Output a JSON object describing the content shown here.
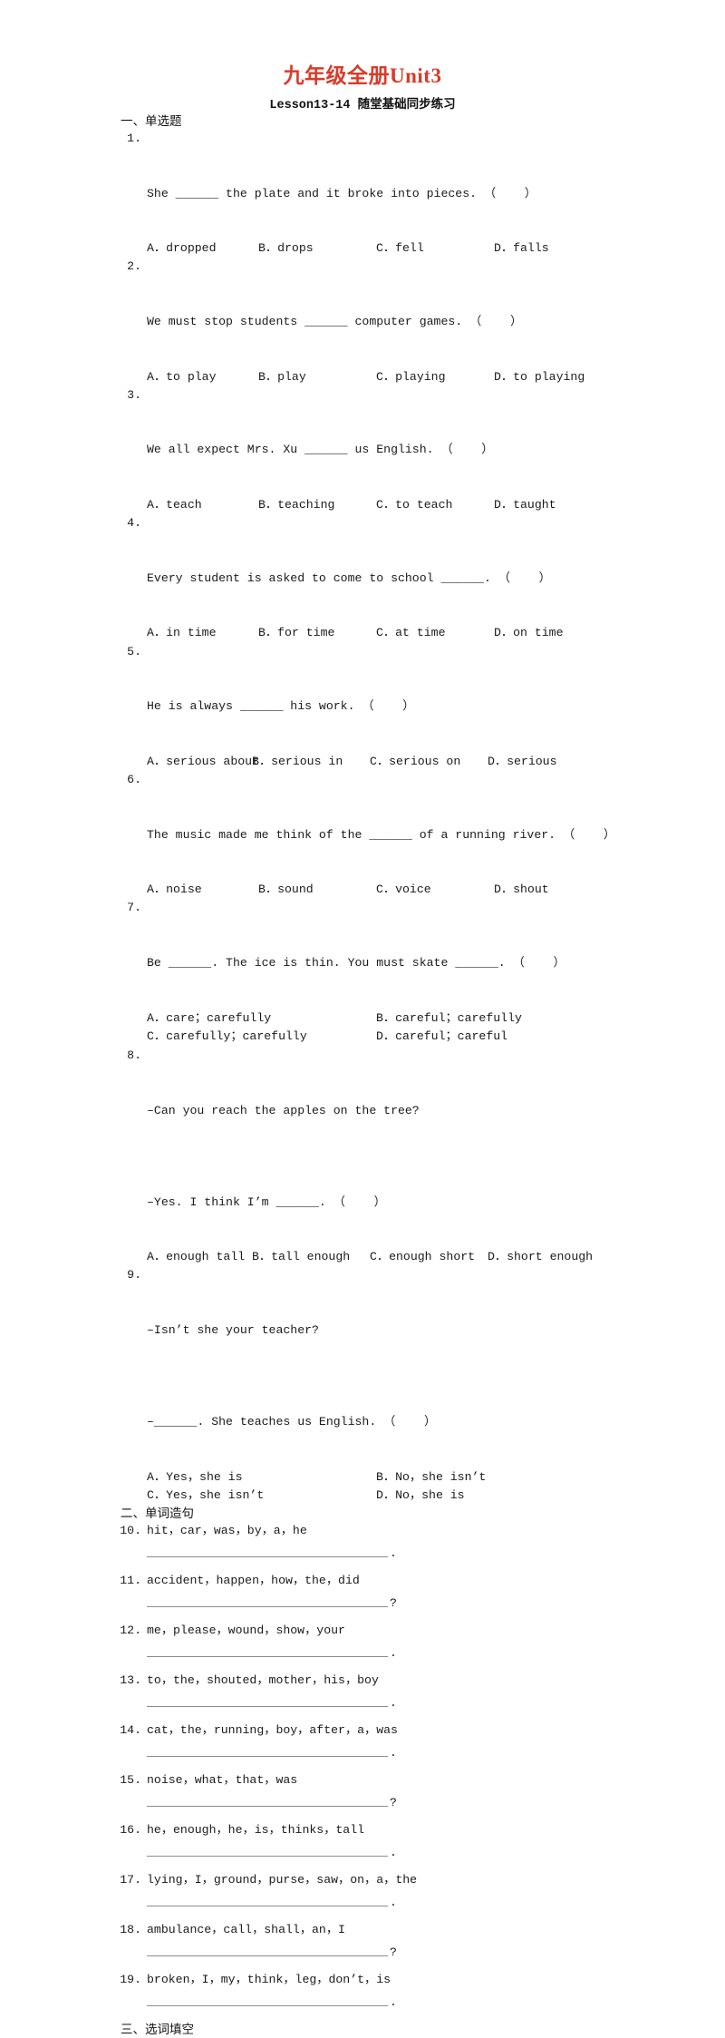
{
  "document": {
    "title": "九年级全册Unit3",
    "title_color": "#d83b2a",
    "subtitle": "Lesson13-14 随堂基础同步练习"
  },
  "sections": [
    {
      "heading": "一、单选题"
    },
    {
      "heading": "二、单词造句"
    },
    {
      "heading": "三、选词填空"
    }
  ],
  "multiple_choice": [
    {
      "number": "1.",
      "stem": "She ______ the plate and it broke into pieces. （    ）",
      "layout": "four-column",
      "options": [
        "A．dropped",
        "B．drops",
        "C．fell",
        "D．falls"
      ]
    },
    {
      "number": "2.",
      "stem": "We must stop students ______ computer games. （    ）",
      "layout": "four-column",
      "options": [
        "A．to play",
        "B．play",
        "C．playing",
        "D．to playing"
      ]
    },
    {
      "number": "3.",
      "stem": "We all expect Mrs. Xu ______ us English. （    ）",
      "layout": "four-column",
      "options": [
        "A．teach",
        "B．teaching",
        "C．to teach",
        "D．taught"
      ]
    },
    {
      "number": "4.",
      "stem": "Every student is asked to come to school ______. （    ）",
      "layout": "four-column",
      "options": [
        "A．in time",
        "B．for time",
        "C．at time",
        "D．on time"
      ]
    },
    {
      "number": "5.",
      "stem": "He is always ______ his work. （    ）",
      "layout": "tight",
      "options": [
        "A．serious about",
        "B．serious in",
        "C．serious on",
        "D．serious"
      ]
    },
    {
      "number": "6.",
      "stem": "The music made me think of the ______ of a running river. （    ）",
      "layout": "four-column",
      "options": [
        "A．noise",
        "B．sound",
        "C．voice",
        "D．shout"
      ]
    },
    {
      "number": "7.",
      "stem": "Be ______. The ice is thin. You must skate ______. （    ）",
      "layout": "two-column",
      "options": [
        "A．care；carefully",
        "B．careful；carefully",
        "C．carefully；carefully",
        "D．careful；careful"
      ]
    },
    {
      "number": "8.",
      "stem": "–Can you reach the apples on the tree?",
      "stem2": "–Yes. I think I’m ______. （    ）",
      "layout": "tight",
      "options": [
        "A．enough tall",
        "B．tall enough",
        "C．enough short",
        "D．short enough"
      ]
    },
    {
      "number": "9.",
      "stem": "–Isn’t she your teacher?",
      "stem2": "–______. She teaches us English. （    ）",
      "layout": "two-column",
      "options": [
        "A．Yes，she is",
        "B．No，she isn’t",
        "C．Yes，she isn’t",
        "D．No，she is"
      ]
    }
  ],
  "word_order": [
    {
      "number": "10.",
      "words": "hit，car，was，by，a，he",
      "punct": "."
    },
    {
      "number": "11.",
      "words": "accident，happen，how，the，did",
      "punct": "?"
    },
    {
      "number": "12.",
      "words": "me，please，wound，show，your",
      "punct": "."
    },
    {
      "number": "13.",
      "words": "to，the，shouted，mother，his，boy",
      "punct": "."
    },
    {
      "number": "14.",
      "words": "cat，the，running，boy，after，a，was",
      "punct": "."
    },
    {
      "number": "15.",
      "words": "noise，what，that，was",
      "punct": "?"
    },
    {
      "number": "16.",
      "words": "he，enough，he，is，thinks，tall",
      "punct": "."
    },
    {
      "number": "17.",
      "words": "lying，I，ground，purse，saw，on，a，the",
      "punct": "."
    },
    {
      "number": "18.",
      "words": "ambulance，call，shall，an，I",
      "punct": "?"
    },
    {
      "number": "19.",
      "words": "broken，I，my，think，leg，don’t，is",
      "punct": "."
    }
  ]
}
